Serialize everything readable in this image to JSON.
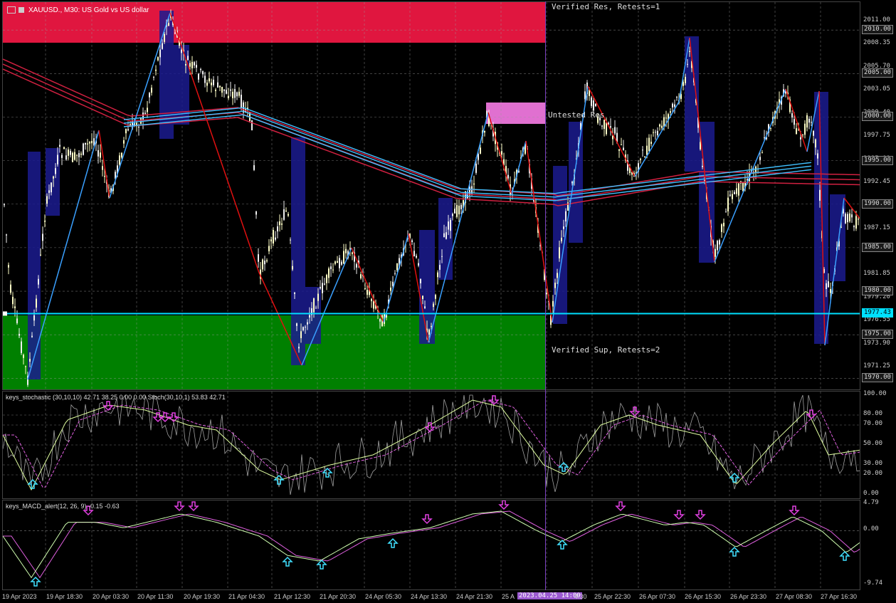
{
  "window": {
    "title": "XAUUSD., M30:  US Gold vs US dollar"
  },
  "zones": {
    "resistance_label": "Verified Res, Retests=1",
    "untested_label": "Untested Res",
    "support_label": "Verified Sup, Retests=2",
    "resistance_color": "#e0163f",
    "support_color": "#008000",
    "untested_color": "#e070d0"
  },
  "price_axis": {
    "ticks": [
      "2011.00",
      "2008.35",
      "2005.70",
      "2003.05",
      "2000.40",
      "1997.75",
      "1995.09",
      "1992.45",
      "1989.80",
      "1987.15",
      "1984.50",
      "1981.85",
      "1979.20",
      "1976.55",
      "1973.90",
      "1971.25"
    ],
    "boxed": [
      "2010.00",
      "2005.00",
      "2000.00",
      "1995.00",
      "1990.00",
      "1985.00",
      "1980.00",
      "1975.00",
      "1970.00"
    ],
    "current_price": "1977.43"
  },
  "stochastic": {
    "title": "keys_stochastic (30,10,10) 42.71 38.25 0.00 0.00 Stoch(30,10,1) 53.83 42.71",
    "ticks": [
      "100.00",
      "80.00",
      "70.00",
      "50.00",
      "30.00",
      "20.00",
      "0.00"
    ]
  },
  "macd": {
    "title": "keys_MACD_alert(12, 26, 9) -0.15 -0.63",
    "ticks": [
      "4.79",
      "0.00",
      "-9.74"
    ]
  },
  "time_axis": {
    "labels": [
      "19 Apr 2023",
      "19 Apr 18:30",
      "20 Apr 03:30",
      "20 Apr 11:30",
      "20 Apr 19:30",
      "21 Apr 04:30",
      "21 Apr 12:30",
      "21 Apr 20:30",
      "24 Apr 05:30",
      "24 Apr 13:30",
      "24 Apr 21:30",
      "25 A",
      "4:30",
      "25 Apr 22:30",
      "26 Apr 07:30",
      "26 Apr 15:30",
      "26 Apr 23:30",
      "27 Apr 08:30",
      "27 Apr 16:30"
    ],
    "cursor": "2023.04.25 14:00"
  }
}
